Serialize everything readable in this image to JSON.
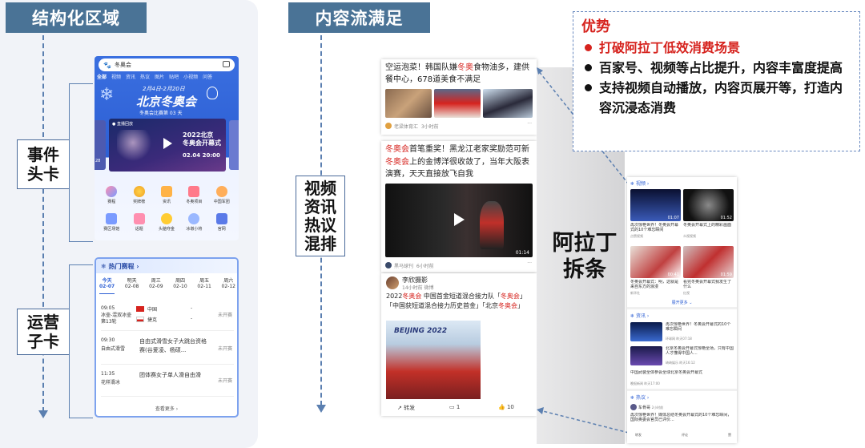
{
  "headers": {
    "structured": "结构化区域",
    "content_flow": "内容流满足"
  },
  "labels": {
    "event_header": "事件\n头卡",
    "ops_card": "运营\n子卡",
    "mixed": "视频\n资讯\n热议\n混排",
    "arading": "阿拉丁\n拆条"
  },
  "advantages": {
    "title": "优势",
    "items": [
      {
        "text": "打破阿拉丁低效消费场景",
        "highlight": true
      },
      {
        "text": "百家号、视频等占比提升，内容丰富度提高",
        "highlight": false
      },
      {
        "text": "支持视频自动播放，内容页展开等，打造内容沉浸态消费",
        "highlight": false
      }
    ]
  },
  "event_card": {
    "search_text": "冬奥会",
    "tabs": [
      "全部",
      "视频",
      "资讯",
      "热议",
      "图片",
      "贴吧",
      "小视频",
      "问答"
    ],
    "banner_dates": "2月4日-2月20日",
    "banner_title": "北京冬奥会",
    "banner_sub": "冬奥会比赛第 03 天",
    "video_tag": "直播回放",
    "video_title": "2022北京\n冬奥会开幕式",
    "video_time": "02.04 20:00",
    "video_side": "28",
    "grid": [
      "赛程",
      "奖牌榜",
      "资讯",
      "冬奥项目",
      "中国军团",
      "赛区场馆",
      "话题",
      "头脑夺金",
      "冰墩小将",
      "官网"
    ]
  },
  "schedule_card": {
    "title": "热门赛程",
    "days": [
      {
        "d": "今天",
        "n": "02-07"
      },
      {
        "d": "明天",
        "n": "02-08"
      },
      {
        "d": "周三",
        "n": "02-09"
      },
      {
        "d": "周四",
        "n": "02-10"
      },
      {
        "d": "周五",
        "n": "02-11"
      },
      {
        "d": "周六",
        "n": "02-12"
      }
    ],
    "rows": [
      {
        "time": "09:05",
        "event": "冰壶-混双冰壶第13轮",
        "t1": "中国",
        "t2": "捷克",
        "s1": "-",
        "s2": "-",
        "status": "未开赛"
      },
      {
        "time": "09:30",
        "event": "自由式滑雪",
        "desc": "自由式滑雪女子大跳台资格赛(谷爱凌、杨硕...",
        "status": "未开赛"
      },
      {
        "time": "11:35",
        "event": "花样滑冰",
        "desc": "团体赛女子单人滑自由滑",
        "status": "未开赛"
      }
    ],
    "more": "查看更多"
  },
  "feed": [
    {
      "title_pre": "空运泡菜！韩国队嫌",
      "title_hl": "冬奥",
      "title_post": "食物油多，建供餐中心，678道美食不满足",
      "source": "老梁体育汇",
      "time": "3小时前"
    },
    {
      "title_hl": "冬奥会",
      "title_post": "首笔重奖！黑龙江老家奖励范可新",
      "title2_hl": "冬奥会",
      "title2_post": "上的金博洋很收敛了，当年大阪表演赛，天天直接放飞自我",
      "duration": "01:14",
      "source": "黑马球刊",
      "time": "6小时前"
    },
    {
      "author": "李欣摄影",
      "meta": "14小时前 微博",
      "text_pre": "2022",
      "text_hl1": "冬奥会",
      "text_mid1": " 中国首金短道混合接力队「",
      "text_hl2": "冬奥会",
      "text_mid2": "」「中国获短道混合接力历史首金」「北京",
      "text_hl3": "冬奥会",
      "text_post": "」",
      "watermark": "BEIJING 2022",
      "share": "转发",
      "comments": "1",
      "likes": "10"
    }
  ],
  "right_card": {
    "video_header": "视频",
    "videos": [
      {
        "title": "再次惊艳世界！冬奥会开幕式的10个难忘瞬间",
        "src": "点赞视频",
        "dur": "01:07"
      },
      {
        "title": "冬奥会开幕式上的精彩画面",
        "src": "众视视频",
        "dur": "01:52"
      },
      {
        "title": "冬奥会开幕式：明，这就是来自东方的浪漫",
        "src": "新华社",
        "dur": "00:41"
      },
      {
        "title": "看完冬奥会开幕式我发生了什么",
        "src": "红视",
        "dur": "01:59"
      }
    ],
    "expand": "展开更多",
    "news_header": "资讯",
    "news": [
      {
        "title": "再次惊艳世界！冬奥会开幕式的10个难忘瞬间",
        "src": "环球网",
        "time": "昨天07:18"
      },
      {
        "title": "北京冬奥会开幕式惊艳全场，只有中国人才懂得中国人...",
        "src": "琦琦娱乐",
        "time": "昨天16:12"
      },
      {
        "title": "中国武装全体参会全球北京冬奥会开幕式",
        "src": "晚报新闻",
        "time": "昨天17:00"
      }
    ],
    "hot_header": "热议",
    "hot": {
      "user": "车骨哥",
      "time": "2小时前",
      "text": "再次惊艳世界！媒体总结冬奥会开幕式的10个难忘瞬间，国际奥委会官员已评价..."
    },
    "actions": [
      "转发",
      "评论",
      "赞"
    ]
  },
  "colors": {
    "header_bg": "#4a7396",
    "accent_red": "#d6231e",
    "event_blue": "#2d5fd4",
    "dash_blue": "#5b7fb0"
  }
}
